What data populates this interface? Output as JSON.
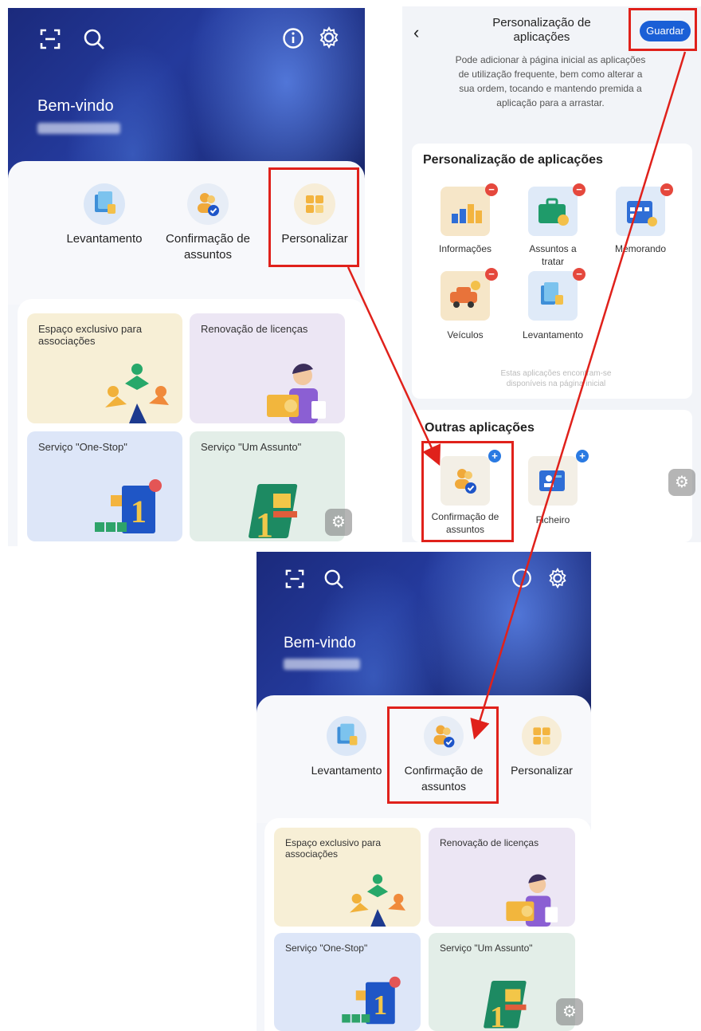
{
  "screen1": {
    "welcome": "Bem-vindo",
    "quick": [
      {
        "label": "Levantamento",
        "icon": "withdrawal-icon"
      },
      {
        "label": "Confirmação de assuntos",
        "icon": "confirm-matters-icon"
      },
      {
        "label": "Personalizar",
        "icon": "customize-icon"
      }
    ],
    "cards": [
      {
        "label": "Espaço exclusivo para associações"
      },
      {
        "label": "Renovação de licenças"
      },
      {
        "label": "Serviço \"One-Stop\""
      },
      {
        "label": "Serviço \"Um Assunto\""
      }
    ]
  },
  "screen2": {
    "title": "Personalização de aplicações",
    "save_label": "Guardar",
    "description": "Pode adicionar à página inicial as aplicações de utilização frequente, bem como alterar a sua ordem, tocando e mantendo premida a aplicação para a arrastar.",
    "section_title": "Personalização de aplicações",
    "apps": [
      {
        "label": "Informações"
      },
      {
        "label": "Assuntos a tratar"
      },
      {
        "label": "Memorando"
      },
      {
        "label": "Veículos"
      },
      {
        "label": "Levantamento"
      }
    ],
    "hint": "Estas aplicações encontram-se disponíveis na página inicial",
    "other_title": "Outras aplicações",
    "other_apps": [
      {
        "label": "Confirmação de assuntos"
      },
      {
        "label": "Ficheiro"
      }
    ]
  },
  "screen3": {
    "welcome": "Bem-vindo",
    "quick": [
      {
        "label": "Levantamento"
      },
      {
        "label": "Confirmação de assuntos"
      },
      {
        "label": "Personalizar"
      }
    ],
    "cards": [
      {
        "label": "Espaço exclusivo para associações"
      },
      {
        "label": "Renovação de licenças"
      },
      {
        "label": "Serviço \"One-Stop\""
      },
      {
        "label": "Serviço \"Um Assunto\""
      }
    ]
  },
  "colors": {
    "highlight": "#e0211b",
    "hero": "#1b2a7c",
    "save": "#1a5fd6"
  }
}
